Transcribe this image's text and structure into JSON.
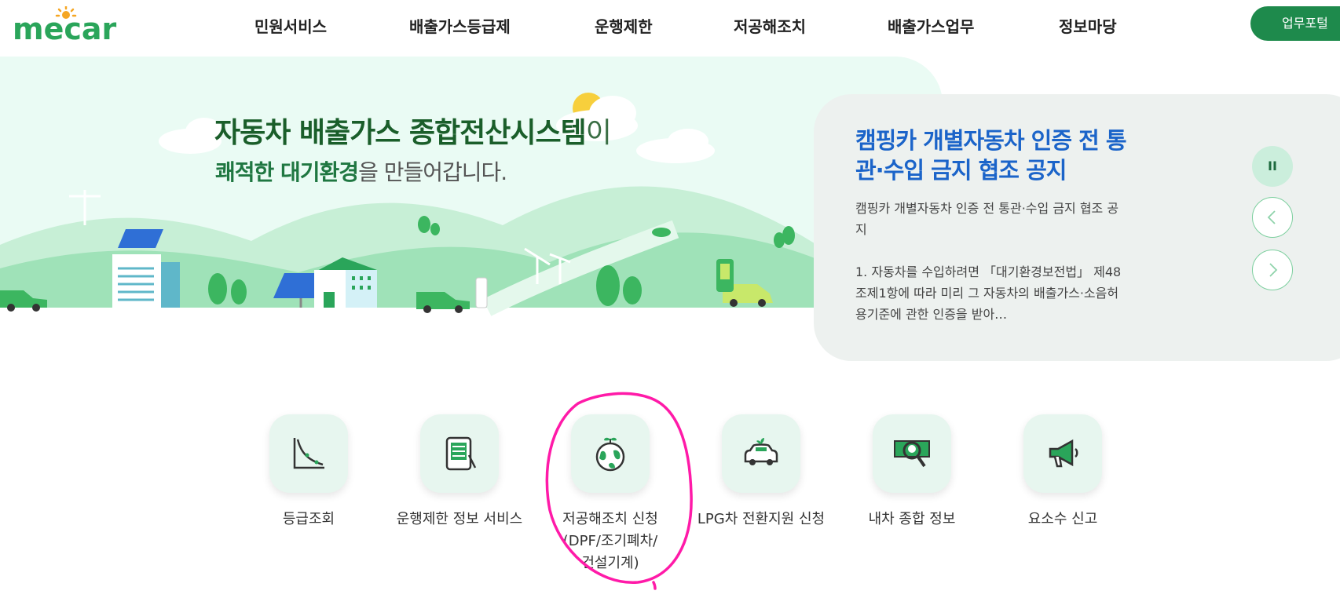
{
  "header": {
    "logo_text": "mecar",
    "nav": [
      "민원서비스",
      "배출가스등급제",
      "운행제한",
      "저공해조치",
      "배출가스업무",
      "정보마당"
    ],
    "portal_button": "업무포털"
  },
  "hero": {
    "headline_bold": "자동차 배출가스 종합전산시스템",
    "headline_suffix": "이",
    "subline_bold": "쾌적한 대기환경",
    "subline_rest": "을 만들어갑니다."
  },
  "notice": {
    "title": "캠핑카 개별자동차 인증 전 통관·수입 금지 협조 공지",
    "summary": "캠핑카 개별자동차 인증 전 통관·수입 금지 협조 공지",
    "detail": "1. 자동차를 수입하려면 「대기환경보전법」 제48조제1항에 따라 미리 그 자동차의 배출가스·소음허용기준에 관한 인증을 받아…",
    "pause_label": "II"
  },
  "quick_menu": [
    {
      "label": "등급조회",
      "icon": "chart-curve-icon"
    },
    {
      "label": "운행제한 정보 서비스",
      "icon": "tablet-pen-icon"
    },
    {
      "label": "저공해조치 신청\n(DPF/조기폐차/\n건설기계)",
      "icon": "earth-sprout-icon"
    },
    {
      "label": "LPG차 전환지원 신청",
      "icon": "eco-car-icon"
    },
    {
      "label": "내차 종합 정보",
      "icon": "money-search-icon"
    },
    {
      "label": "요소수 신고",
      "icon": "megaphone-icon"
    }
  ],
  "colors": {
    "brand_green": "#1e8a4c",
    "notice_blue": "#1b64c9",
    "annotation_magenta": "#ff1aa8"
  }
}
